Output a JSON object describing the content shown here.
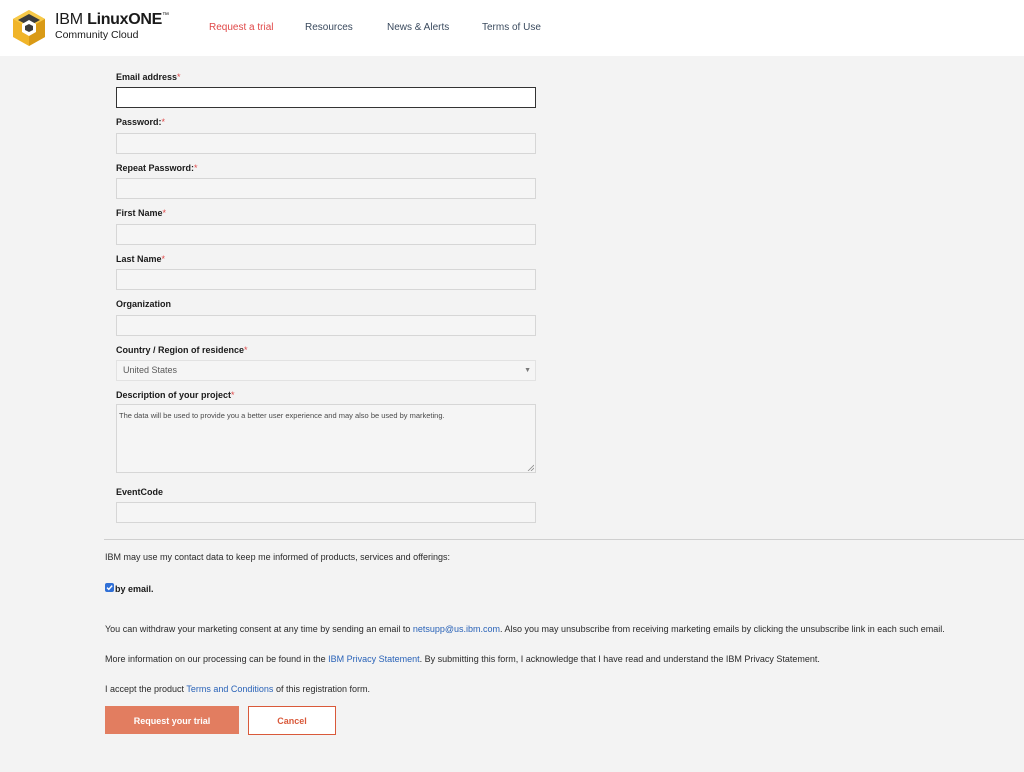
{
  "header": {
    "brand_light": "IBM ",
    "brand_bold": "LinuxONE",
    "brand_tm": "™",
    "brand_sub": "Community Cloud",
    "nav": [
      {
        "label": "Request a trial",
        "active": true
      },
      {
        "label": "Resources"
      },
      {
        "label": "News & Alerts"
      },
      {
        "label": "Terms of Use"
      }
    ]
  },
  "form": {
    "required_mark": "*",
    "email": {
      "label": "Email address",
      "value": ""
    },
    "password": {
      "label": "Password:",
      "value": ""
    },
    "repeat_password": {
      "label": "Repeat Password:",
      "value": ""
    },
    "first_name": {
      "label": "First Name",
      "value": ""
    },
    "last_name": {
      "label": "Last Name",
      "value": ""
    },
    "organization": {
      "label": "Organization",
      "value": ""
    },
    "country": {
      "label": "Country / Region of residence",
      "selected": "United States"
    },
    "description": {
      "label": "Description of your project",
      "value": "The data will be used to provide you a better user experience and may also be used by marketing."
    },
    "event_code": {
      "label": "EventCode",
      "value": ""
    }
  },
  "consent": {
    "intro": "IBM may use my contact data to keep me informed of products, services and offerings:",
    "checkbox_label": "by email.",
    "checked": true,
    "withdraw_pre": "You can withdraw your marketing consent at any time by sending an email to ",
    "withdraw_email": "netsupp@us.ibm.com",
    "withdraw_post": ". Also you may unsubscribe from receiving marketing emails by clicking the unsubscribe link in each such email.",
    "privacy_pre": "More information on our processing can be found in the ",
    "privacy_link": "IBM Privacy Statement",
    "privacy_post": ". By submitting this form, I acknowledge that I have read and understand the IBM Privacy Statement.",
    "terms_pre": "I accept the product ",
    "terms_link": "Terms and Conditions",
    "terms_post": " of this registration form."
  },
  "actions": {
    "submit_label": "Request your trial",
    "cancel_label": "Cancel"
  },
  "colors": {
    "accent": "#e27d60",
    "accent_border": "#d9593a",
    "link": "#2a63b8",
    "nav_active": "#e04848",
    "logo_yellow": "#f0b429",
    "logo_dark": "#3b3b3b"
  },
  "icons": {
    "logo": "linuxone-cube-logo",
    "select": "chevron-down-icon",
    "textarea": "resize-handle-icon"
  }
}
